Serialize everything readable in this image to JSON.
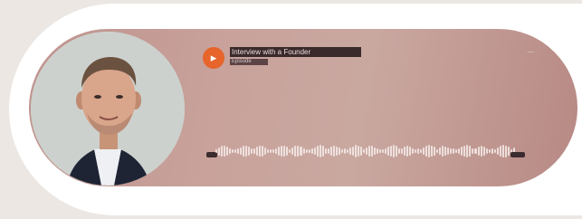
{
  "player": {
    "logo_glyph": "▸",
    "logo_color": "#e7642a",
    "track_title": "Interview with a Founder",
    "track_subtitle": "Episode",
    "corner_text": "—",
    "accent_color": "#bf938d"
  },
  "icons": {
    "logo": "play-logo-icon",
    "avatar": "speaker-avatar"
  }
}
